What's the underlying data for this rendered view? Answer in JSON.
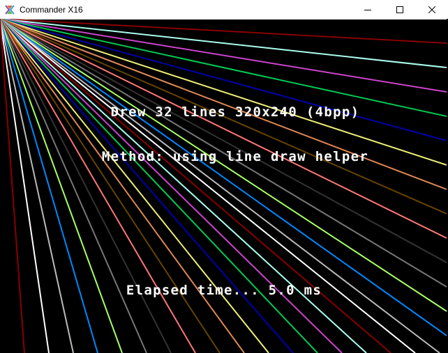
{
  "window": {
    "title": "Commander X16",
    "icon": "x16-logo-icon",
    "controls": [
      "minimize-icon",
      "maximize-icon",
      "close-icon"
    ]
  },
  "screen": {
    "background": "#000000",
    "text_color": "#ffffff",
    "line1": "Drew 32 lines 320x240 (4bpp)",
    "line2": "Method: using line draw helper",
    "line3": "Elapsed time... 5.0 ms",
    "line_count": 32,
    "palette": [
      "#ffffff",
      "#880000",
      "#aaffee",
      "#cc44cc",
      "#00cc55",
      "#0000aa",
      "#eeee77",
      "#dd8855",
      "#664400",
      "#ff7777",
      "#333333",
      "#777777",
      "#aaff66",
      "#0088ff",
      "#bbbbbb",
      "#ffffff",
      "#880000",
      "#aaffee",
      "#cc44cc",
      "#00cc55",
      "#0000aa",
      "#eeee77",
      "#dd8855",
      "#664400",
      "#ff7777",
      "#333333",
      "#777777",
      "#aaff66",
      "#0088ff",
      "#bbbbbb",
      "#ffffff",
      "#880000"
    ]
  }
}
